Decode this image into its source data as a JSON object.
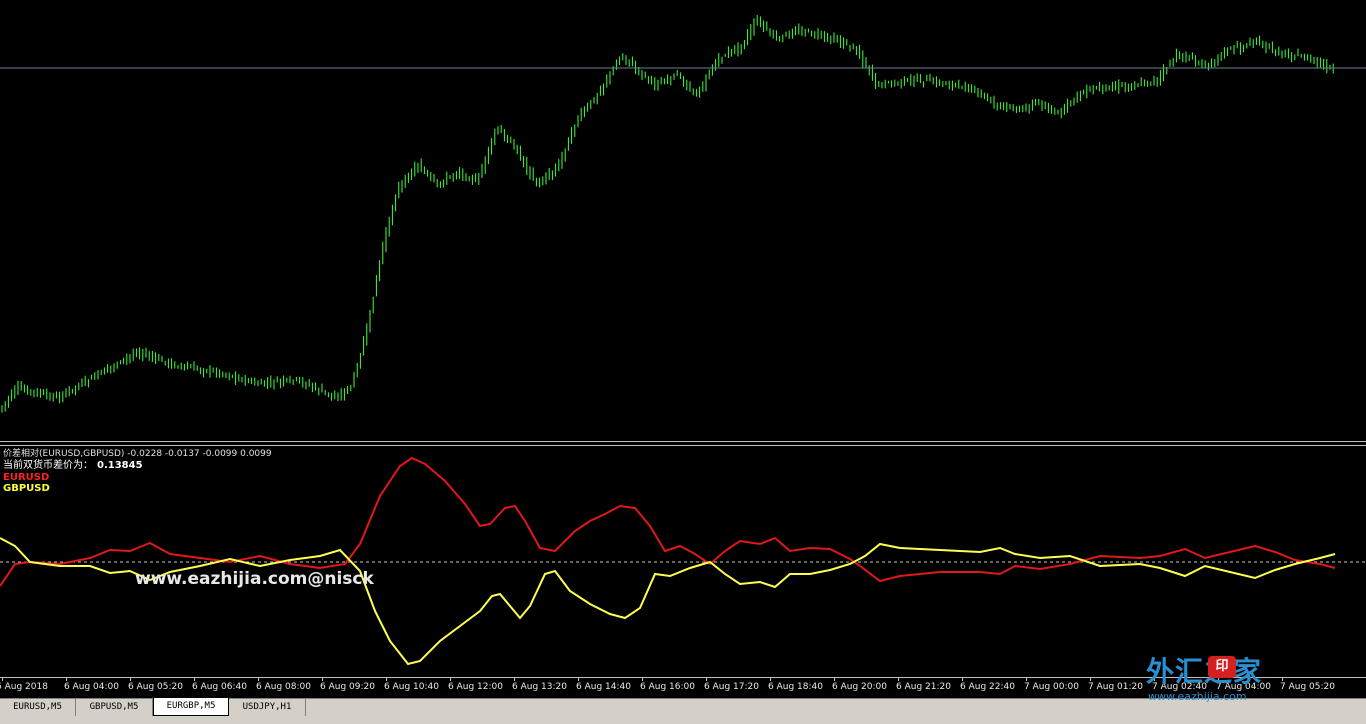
{
  "indicator": {
    "info": "价差相对(EURUSD,GBPUSD) -0.0228 -0.0137 -0.0099 0.0099",
    "current_label": "当前双货币差价为：",
    "current_value": "0.13845",
    "legend": [
      {
        "name": "EURUSD",
        "color": "#ff2020"
      },
      {
        "name": "GBPUSD",
        "color": "#ffff40"
      }
    ]
  },
  "colors": {
    "candles": "#40ff40",
    "price_line": "#6a7f99",
    "zero_line": "#c8c8c8",
    "eurusd": "#e01818",
    "gbpusd": "#ffff50"
  },
  "watermark": "www.eazhijia.com@nisck",
  "time_axis": [
    "6 Aug 2018",
    "6 Aug 04:00",
    "6 Aug 05:20",
    "6 Aug 06:40",
    "6 Aug 08:00",
    "6 Aug 09:20",
    "6 Aug 10:40",
    "6 Aug 12:00",
    "6 Aug 13:20",
    "6 Aug 14:40",
    "6 Aug 16:00",
    "6 Aug 17:20",
    "6 Aug 18:40",
    "6 Aug 20:00",
    "6 Aug 21:20",
    "6 Aug 22:40",
    "7 Aug 00:00",
    "7 Aug 01:20",
    "7 Aug 02:40",
    "7 Aug 04:00",
    "7 Aug 05:20"
  ],
  "tabs": [
    {
      "label": "EURUSD,M5",
      "active": false
    },
    {
      "label": "GBPUSD,M5",
      "active": false
    },
    {
      "label": "EURGBP,M5",
      "active": true
    },
    {
      "label": "USDJPY,H1",
      "active": false
    }
  ],
  "logo": {
    "cn_text": "外汇之家",
    "badge": "印",
    "url": "www.eazhijia.com"
  }
}
